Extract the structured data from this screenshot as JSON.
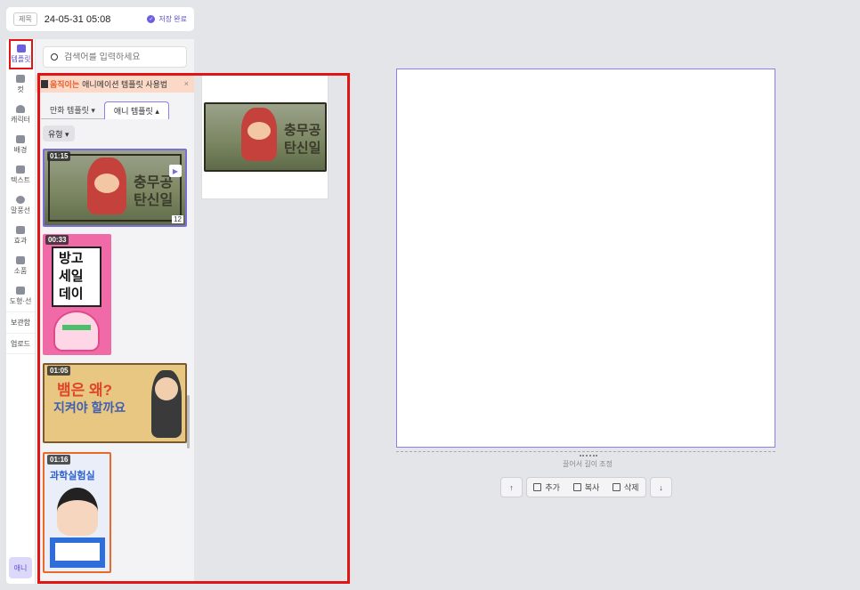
{
  "header": {
    "title_tag": "제목",
    "title": "24-05-31 05:08",
    "save_status": "저장 완료"
  },
  "sidebar": {
    "items": [
      {
        "label": "템플릿",
        "icon": "template-icon"
      },
      {
        "label": "컷",
        "icon": "cut-icon"
      },
      {
        "label": "캐릭터",
        "icon": "character-icon"
      },
      {
        "label": "배경",
        "icon": "background-icon"
      },
      {
        "label": "텍스트",
        "icon": "text-icon"
      },
      {
        "label": "말풍선",
        "icon": "speech-bubble-icon"
      },
      {
        "label": "효과",
        "icon": "effect-icon"
      },
      {
        "label": "소품",
        "icon": "props-icon"
      },
      {
        "label": "도형·선",
        "icon": "shape-icon"
      }
    ],
    "text_items": [
      "보관함",
      "업로드"
    ],
    "bottom_button": "애니"
  },
  "panel": {
    "search_placeholder": "검색어를 입력하세요",
    "banner_highlight": "움직이는",
    "banner_text": "애니메이션 템플릿 사용법",
    "banner_close": "×",
    "tabs": [
      {
        "label": "만화 템플릿 ▾",
        "active": false
      },
      {
        "label": "애니 템플릿 ▴",
        "active": true
      }
    ],
    "type_filter": "유형 ▾",
    "templates": [
      {
        "duration": "01:15",
        "pages": "12",
        "line1": "충무공",
        "line2": "탄신일"
      },
      {
        "duration": "00:33",
        "line1": "방고",
        "line2": "세일",
        "line3": "데이"
      },
      {
        "duration": "01:05",
        "line1": "뱀은 왜?",
        "line2": "지켜야 할까요"
      },
      {
        "duration": "01:16",
        "line1": "과학실험실"
      }
    ]
  },
  "preview": {
    "line1": "충무공",
    "line2": "탄신일"
  },
  "canvas": {
    "drag_label": "끌어서 길이 조정",
    "controls": {
      "up": "↑",
      "add": "추가",
      "copy": "복사",
      "delete": "삭제",
      "down": "↓"
    }
  }
}
